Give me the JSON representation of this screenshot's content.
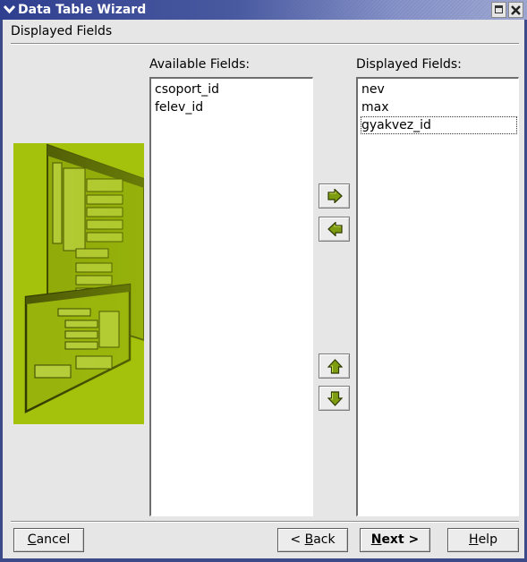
{
  "window": {
    "title": "Data Table Wizard",
    "menu_glyph": "⌄",
    "close_glyph": "✕"
  },
  "page": {
    "heading": "Displayed Fields"
  },
  "available": {
    "label": "Available Fields:",
    "items": [
      "csoport_id",
      "felev_id"
    ]
  },
  "displayed": {
    "label": "Displayed Fields:",
    "items": [
      "nev",
      "max",
      "gyakvez_id"
    ],
    "focused_index": 2
  },
  "arrow_buttons": {
    "add": "move-right",
    "remove": "move-left",
    "up": "move-up",
    "down": "move-down",
    "icon_color": "#6f8c10"
  },
  "buttons": {
    "cancel": {
      "mnemonic": "C",
      "rest": "ancel"
    },
    "back": {
      "prefix": "< ",
      "mnemonic": "B",
      "rest": "ack"
    },
    "next": {
      "mnemonic": "N",
      "rest": "ext >"
    },
    "help": {
      "mnemonic": "H",
      "rest": "elp"
    }
  },
  "colors": {
    "titlebar": "#3c4a8a",
    "side_image": "#a4c20c",
    "background": "#e6e6e6"
  }
}
